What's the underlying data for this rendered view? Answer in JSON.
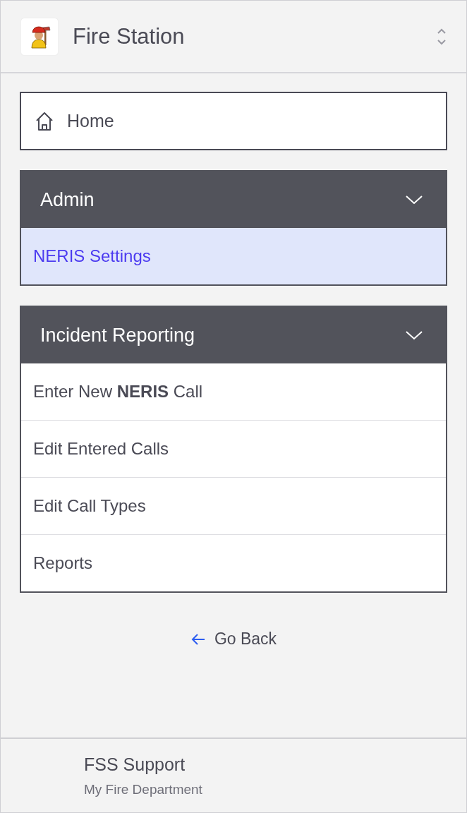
{
  "header": {
    "title": "Fire Station"
  },
  "home": {
    "label": "Home"
  },
  "sections": [
    {
      "title": "Admin",
      "expanded": true,
      "items": [
        {
          "label": "NERIS Settings",
          "selected": true
        }
      ]
    },
    {
      "title": "Incident Reporting",
      "expanded": true,
      "items": [
        {
          "label": "Enter New **NERIS** Call",
          "selected": false
        },
        {
          "label": "Edit Entered Calls",
          "selected": false
        },
        {
          "label": "Edit Call Types",
          "selected": false
        },
        {
          "label": "Reports",
          "selected": false
        }
      ]
    }
  ],
  "back": {
    "label": "Go Back"
  },
  "footer": {
    "name": "FSS Support",
    "department": "My Fire Department"
  }
}
